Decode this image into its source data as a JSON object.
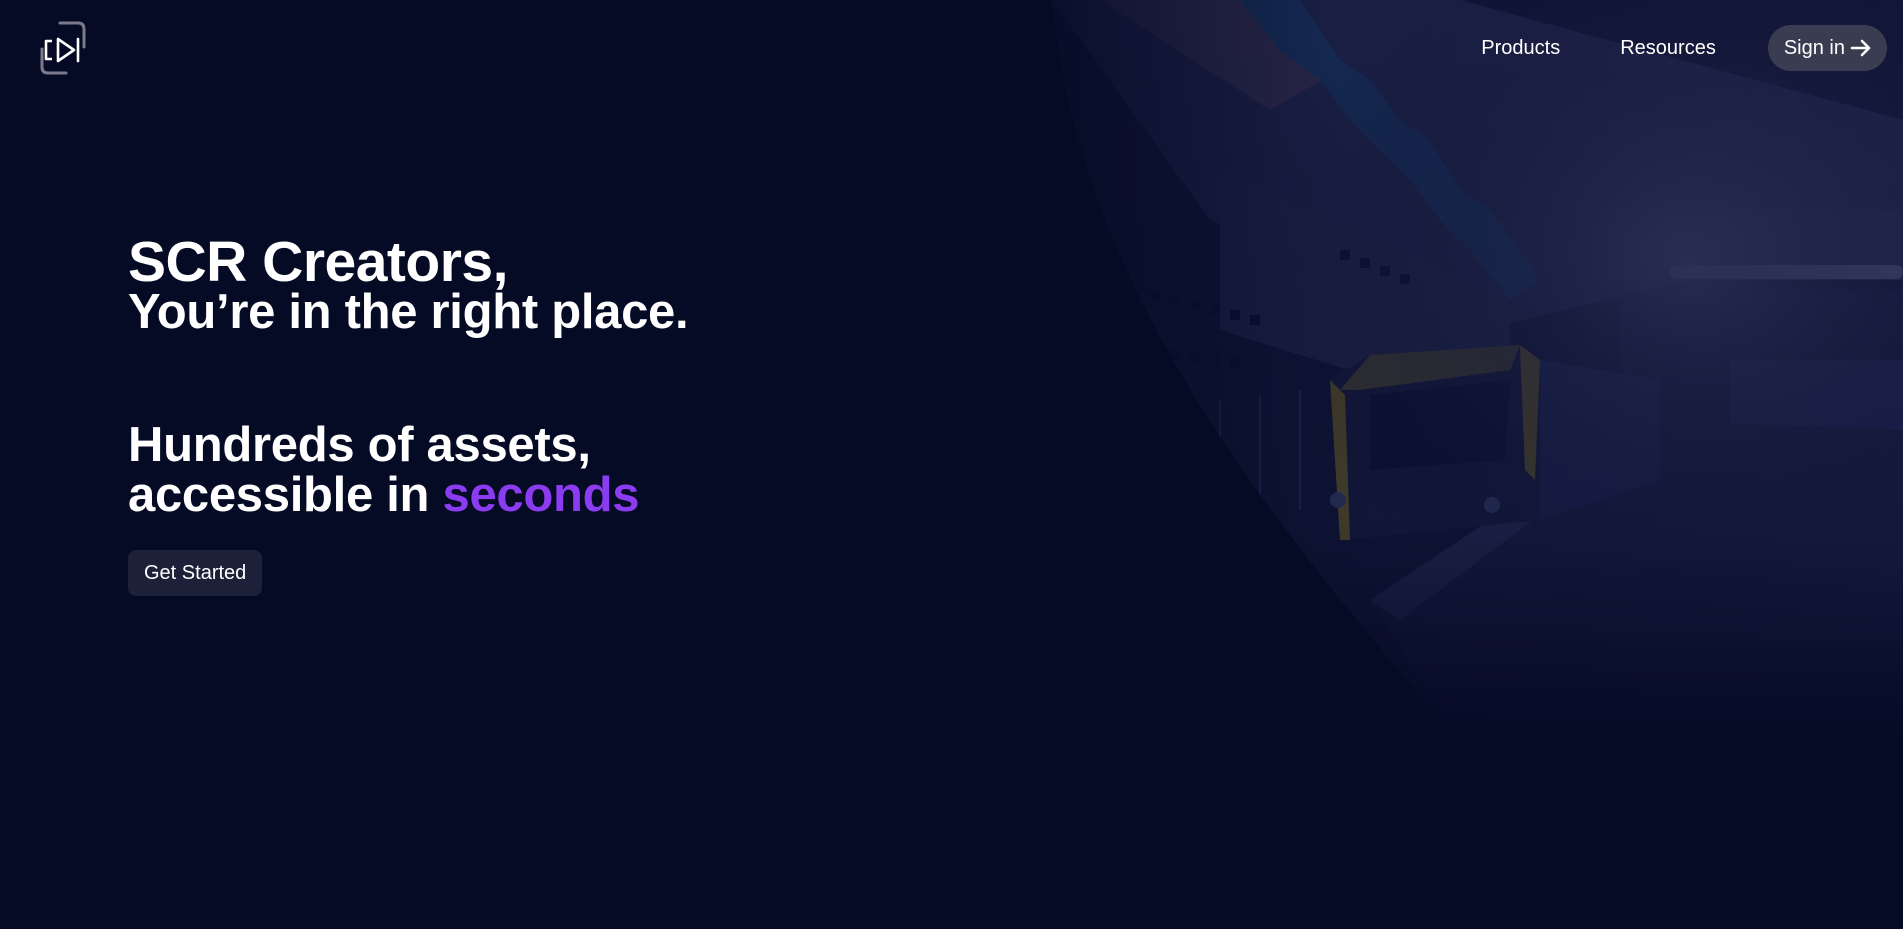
{
  "header": {
    "logo_icon": "video-frame-logo-icon",
    "nav": {
      "products_label": "Products",
      "resources_label": "Resources",
      "signin_label": "Sign in",
      "signin_icon": "arrow-right-icon"
    }
  },
  "hero": {
    "title": "SCR Creators,",
    "subtitle": "You’re in the right place.",
    "tagline_line1": "Hundreds of assets,",
    "tagline_line2_prefix": "accessible in ",
    "tagline_line2_accent": "seconds",
    "cta_label": "Get Started",
    "background_image": "train-station-platform-image"
  },
  "colors": {
    "background": "#050a25",
    "accent": "#8b3cf0",
    "signin_button": "#3a3d52",
    "cta_button": "#1c2038"
  }
}
